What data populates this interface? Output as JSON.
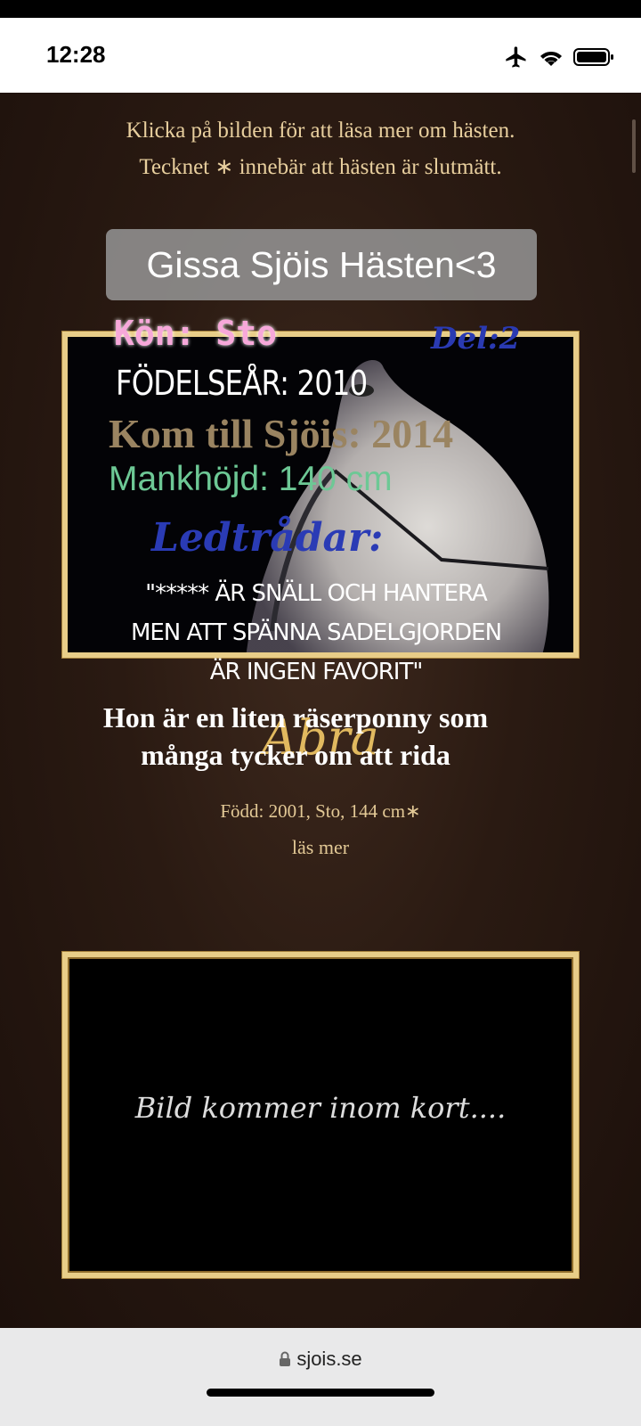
{
  "status_bar": {
    "time": "12:28"
  },
  "intro": {
    "line1": "Klicka på bilden för att läsa mer om hästen.",
    "line2": "Tecknet ∗ innebär att hästen är slutmätt."
  },
  "banner": {
    "text": "Gissa Sjöis Hästen<3"
  },
  "horse_card": {
    "kon": "Kön: Sto",
    "del": "Del:2",
    "fodelsear": "FÖDELSEÅR: 2010",
    "kom_till": "Kom till Sjöis: 2014",
    "mankhojd": "Mankhöjd: 140 cm",
    "ledtradar": "Ledtrådar:",
    "quote": "\"***** ÄR SNÄLL OCH HANTERA MEN ATT SPÄNNA SADELGJORDEN ÄR INGEN FAVORIT\"",
    "name": "Abra",
    "description": "Hon är en liten räserponny som många tycker om att rida",
    "born": "Född: 2001, Sto, 144 cm∗",
    "read_more": "läs mer"
  },
  "second_card": {
    "placeholder": "Bild kommer inom kort...."
  },
  "browser": {
    "url": "sjois.se"
  },
  "colors": {
    "frame": "#e8cd88",
    "background": "#2a1a12",
    "banner": "#969696"
  }
}
